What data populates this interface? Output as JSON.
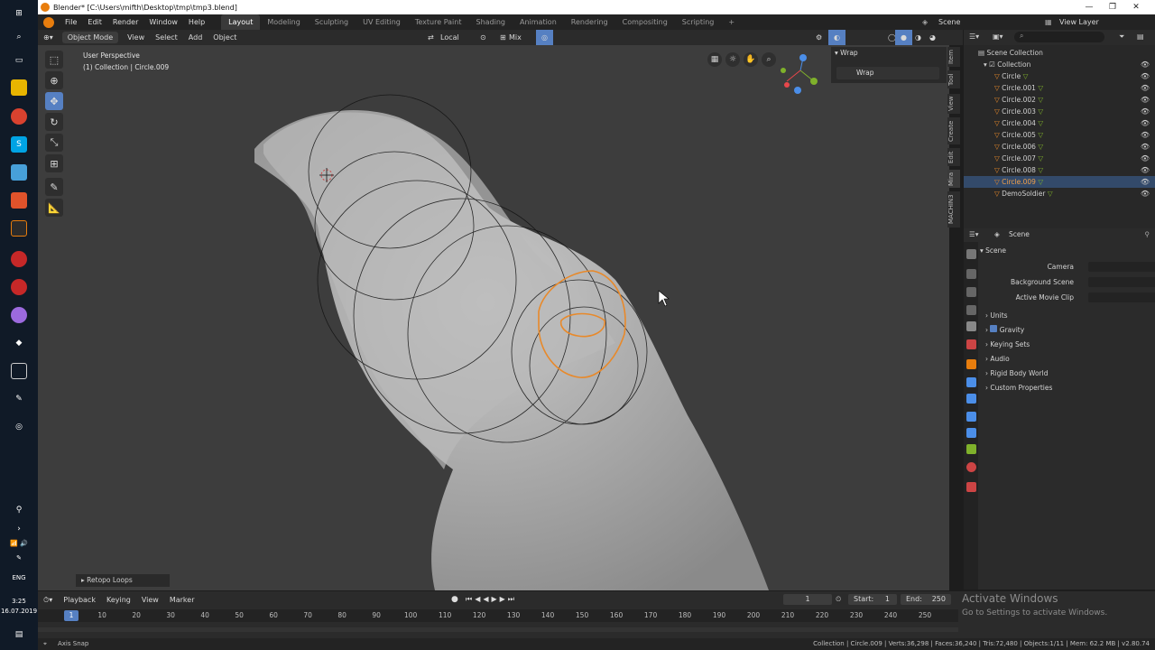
{
  "window": {
    "title": "Blender* [C:\\Users\\mifth\\Desktop\\tmp\\tmp3.blend]"
  },
  "taskbar": {
    "time": "3:25",
    "date": "16.07.2019",
    "lang": "ENG"
  },
  "menu": {
    "items": [
      "File",
      "Edit",
      "Render",
      "Window",
      "Help"
    ]
  },
  "workspaces": [
    "Layout",
    "Modeling",
    "Sculpting",
    "UV Editing",
    "Texture Paint",
    "Shading",
    "Animation",
    "Rendering",
    "Compositing",
    "Scripting"
  ],
  "active_workspace": "Layout",
  "top_right": {
    "scene": "Scene",
    "view_layer": "View Layer"
  },
  "viewport_header": {
    "mode": "Object Mode",
    "menus": [
      "View",
      "Select",
      "Add",
      "Object"
    ],
    "orientation": "Local",
    "snap": "Mix"
  },
  "viewport": {
    "view_name": "User Perspective",
    "collection_info": "(1) Collection | Circle.009",
    "last_op": "Retopo Loops"
  },
  "npanel": {
    "header": "Wrap",
    "button": "Wrap",
    "tabs": [
      "Item",
      "Tool",
      "View",
      "Create",
      "Edit",
      "Mira",
      "MACHIN3"
    ]
  },
  "outliner": {
    "root": "Scene Collection",
    "collection": "Collection",
    "items": [
      "Circle",
      "Circle.001",
      "Circle.002",
      "Circle.003",
      "Circle.004",
      "Circle.005",
      "Circle.006",
      "Circle.007",
      "Circle.008",
      "Circle.009",
      "DemoSoldier"
    ],
    "selected": "Circle.009"
  },
  "properties": {
    "context": "Scene",
    "section": "Scene",
    "camera_label": "Camera",
    "bg_scene_label": "Background Scene",
    "movie_clip_label": "Active Movie Clip",
    "panels": [
      "Units",
      "Gravity",
      "Keying Sets",
      "Audio",
      "Rigid Body World",
      "Custom Properties"
    ]
  },
  "timeline": {
    "menus": [
      "Playback",
      "Keying",
      "View",
      "Marker"
    ],
    "current_frame": "1",
    "start_label": "Start:",
    "start": "1",
    "end_label": "End:",
    "end": "250",
    "ticks": [
      "1",
      "10",
      "20",
      "30",
      "40",
      "50",
      "60",
      "70",
      "80",
      "90",
      "100",
      "110",
      "120",
      "130",
      "140",
      "150",
      "160",
      "170",
      "180",
      "190",
      "200",
      "210",
      "220",
      "230",
      "240",
      "250"
    ]
  },
  "status": {
    "left": "Axis Snap",
    "right": "Collection | Circle.009 | Verts:36,298 | Faces:36,240 | Tris:72,480 | Objects:1/11 | Mem: 62.2 MB | v2.80.74"
  },
  "watermark": {
    "title": "Activate Windows",
    "sub": "Go to Settings to activate Windows."
  },
  "colors": {
    "accent": "#5680c2",
    "selection": "#e8892a",
    "bg": "#3d3d3d"
  }
}
